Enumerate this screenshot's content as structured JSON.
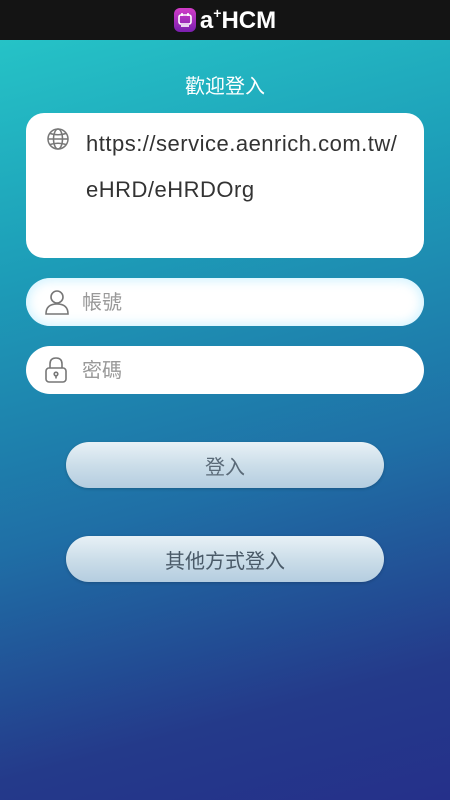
{
  "app": {
    "logo_text": "a",
    "logo_sup": "+",
    "logo_suffix": "HCM",
    "logo_icon": "app-logo-icon"
  },
  "login": {
    "welcome": "歡迎登入",
    "server_url": "https://service.aenrich.com.tw/eHRD/eHRDOrg",
    "username_placeholder": "帳號",
    "password_placeholder": "密碼",
    "login_button": "登入",
    "other_login_button": "其他方式登入"
  },
  "icons": {
    "url": "globe-icon",
    "username": "user-icon",
    "password": "lock-icon"
  },
  "colors": {
    "topbar": "#141414",
    "gradient_top": "#27c9c9",
    "gradient_bottom": "#25308a",
    "logo_accent": "#b02fbf"
  }
}
